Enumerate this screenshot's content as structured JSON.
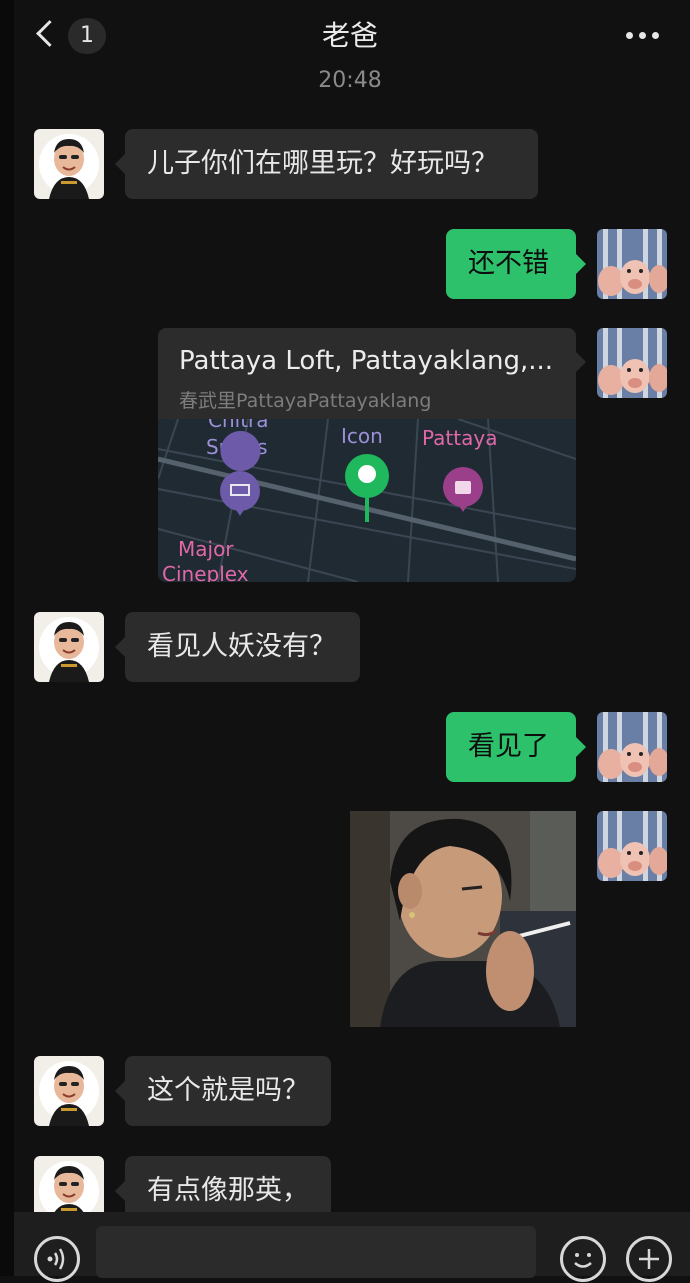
{
  "header": {
    "title": "老爸",
    "unread_count": "1",
    "back_icon": "chevron-left-icon",
    "more_icon": "more-dots-icon"
  },
  "timestamp": "20:48",
  "messages": [
    {
      "sender": "father",
      "type": "text",
      "text": "儿子你们在哪里玩？好玩吗？"
    },
    {
      "sender": "me",
      "type": "text",
      "text": "还不错"
    },
    {
      "sender": "me",
      "type": "location",
      "title": "Pattaya Loft, Pattayaklang,...",
      "subtitle": "春武里PattayaPattayaklang",
      "map_labels": [
        "Chitra",
        "Suites",
        "Icon",
        "Pattaya",
        "Major",
        "Cineplex"
      ]
    },
    {
      "sender": "father",
      "type": "text",
      "text": "看见人妖没有？"
    },
    {
      "sender": "me",
      "type": "text",
      "text": "看见了"
    },
    {
      "sender": "me",
      "type": "image",
      "image": "photo-woman-smoking"
    },
    {
      "sender": "father",
      "type": "text",
      "text": "这个就是吗？"
    },
    {
      "sender": "father",
      "type": "text",
      "text": "有点像那英，"
    }
  ],
  "input_bar": {
    "placeholder": "",
    "voice_icon": "voice-icon",
    "emoji_icon": "emoji-icon",
    "plus_icon": "plus-icon"
  },
  "colors": {
    "background": "#111111",
    "incoming_bubble": "#2c2c2c",
    "outgoing_bubble": "#2ec16b",
    "timestamp": "#8a8a8a",
    "map_background": "#1f2a33",
    "map_pin": "#1fb85c",
    "map_poi": "#9c3f8a"
  }
}
